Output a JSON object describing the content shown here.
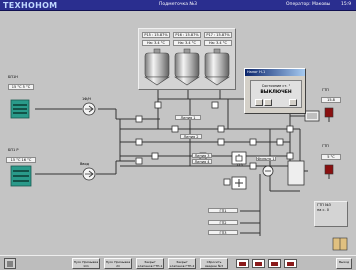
{
  "header": {
    "logo": "ТЕХНОНОМ",
    "title": "Подметочка №3",
    "operator": "Оператор: Маковы",
    "time": "15:9"
  },
  "tanks": {
    "labels": [
      "Р15 : 15.87%",
      "Р16 : 15.87%",
      "Р17 : 15.87%"
    ],
    "values": [
      "На: 3.4 °С",
      "На: 3.4 °С",
      "На: 3.4 °С"
    ]
  },
  "left_units": {
    "top_label": "БП1Н",
    "top_value": "15 °С 5 °С",
    "bottom_label": "БП1 Р",
    "bottom_value": "15 °С 16 °С",
    "valve_top": "1Ф/Н",
    "valve_bottom": "Ввод"
  },
  "lines": {
    "line1": "Линия 1",
    "line2": "Линия 2",
    "line3": "Линия 3",
    "line4": "Линия 4",
    "filter": "Фильтр 1",
    "pos": "125"
  },
  "right_units": {
    "top_label": "ГТП",
    "top_value": "15.8",
    "bottom_label": "ГТП",
    "bottom_value": "5 °С",
    "right_info": "ГТП №3",
    "right_info2": "на с. 0"
  },
  "bottom_values": [
    "ГП1",
    "ГП2",
    "ГП3"
  ],
  "dialog": {
    "caption": "Налог Н-1",
    "line1": "Состояние ст. \"",
    "line2": "ВЫКЛЮЧЕН"
  },
  "footer": {
    "buttons": [
      "Пуск Промывка 1п1",
      "Пуск Промывка 2п",
      "Закрыт клапанов ГТП-1",
      "Закрыт клапанов ГТП-2",
      "Сбросить Аварию №3"
    ],
    "right_button": "Выход"
  }
}
